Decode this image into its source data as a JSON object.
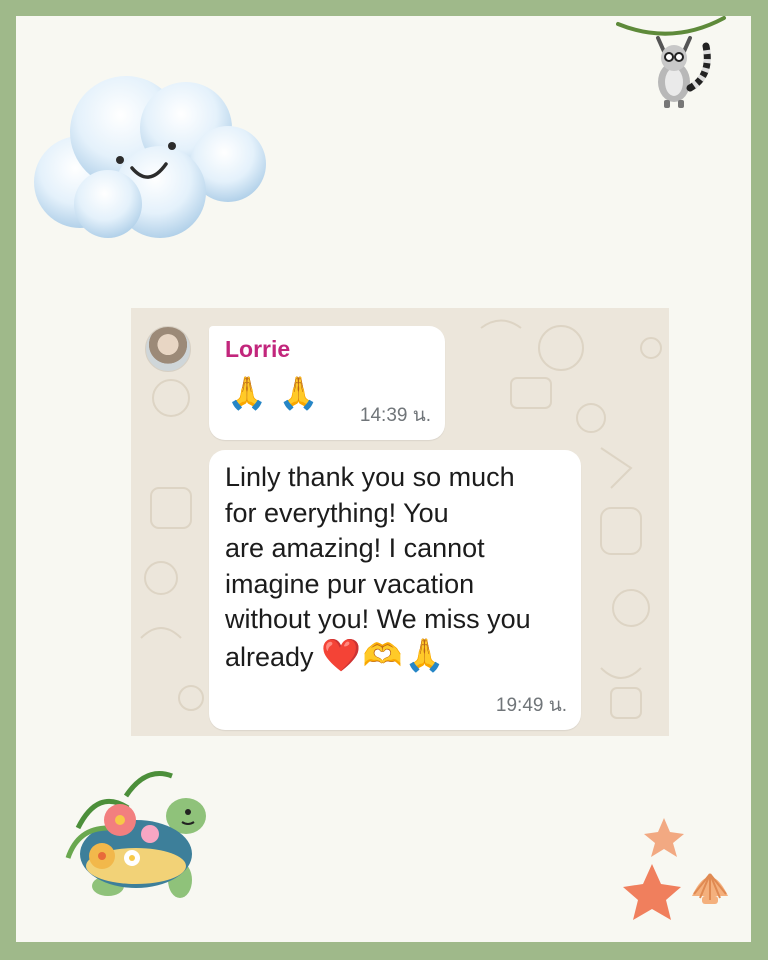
{
  "message_1": {
    "sender": "Lorrie",
    "emojis": "🙏🙏",
    "time": "14:39 น."
  },
  "message_2": {
    "text": "Linly thank you so much\nfor everything! You\nare amazing! I cannot\nimagine pur vacation\nwithout you! We miss you\nalready ",
    "emojis": "❤️🫶🙏",
    "time": "19:49 น."
  },
  "colors": {
    "frame": "#9fb98a",
    "card": "#f8f8f2",
    "chat_bg": "#ece6db",
    "sender": "#c2267c",
    "timestamp": "#707579"
  },
  "icons": [
    "cloud-icon",
    "lemur-icon",
    "turtle-icon",
    "starfish-icon",
    "seashell-icon"
  ]
}
